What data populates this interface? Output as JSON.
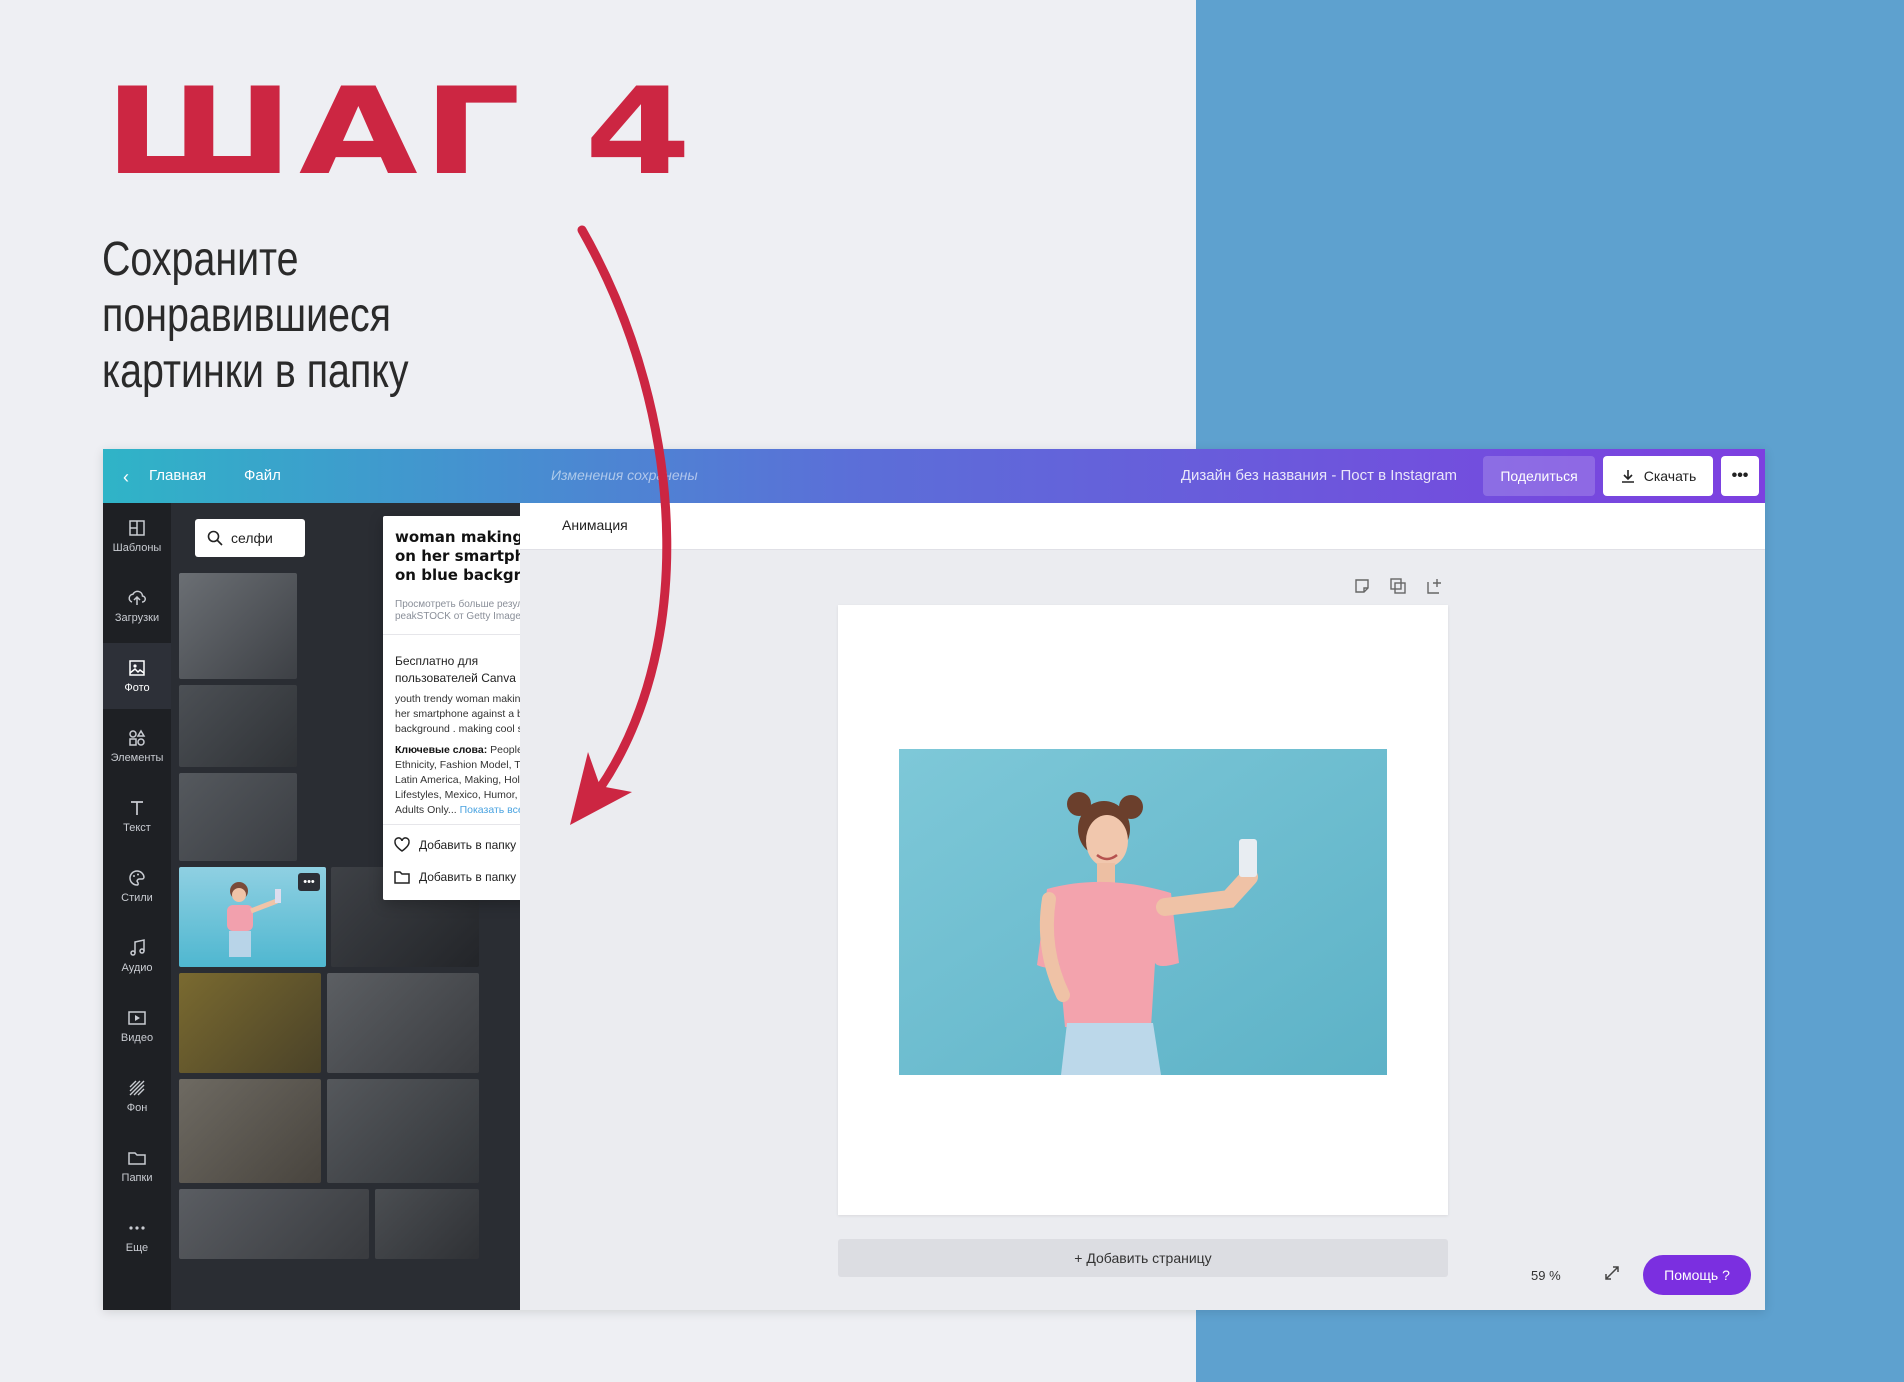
{
  "step": {
    "title": "ШАГ 4",
    "description_lines": [
      "Сохраните",
      "понравившиеся",
      "картинки в папку"
    ]
  },
  "colors": {
    "accent_red": "#cc2642",
    "right_panel_blue": "#5ea1cf",
    "canva_purple": "#7b2fe0"
  },
  "app": {
    "topbar": {
      "back_icon": "chevron-left-icon",
      "home": "Главная",
      "file": "Файл",
      "saving": "Изменения сохранены",
      "doc_name": "Дизайн без названия - Пост в Instagram",
      "share": "Поделиться",
      "download": "Скачать",
      "more": "•••"
    },
    "sidebar": {
      "items": [
        {
          "label": "Шаблоны",
          "icon": "templates-icon"
        },
        {
          "label": "Загрузки",
          "icon": "upload-cloud-icon"
        },
        {
          "label": "Фото",
          "icon": "photo-icon"
        },
        {
          "label": "Элементы",
          "icon": "elements-icon"
        },
        {
          "label": "Текст",
          "icon": "text-icon"
        },
        {
          "label": "Стили",
          "icon": "palette-icon"
        },
        {
          "label": "Аудио",
          "icon": "music-note-icon"
        },
        {
          "label": "Видео",
          "icon": "video-icon"
        },
        {
          "label": "Фон",
          "icon": "background-icon"
        },
        {
          "label": "Папки",
          "icon": "folder-icon"
        },
        {
          "label": "Еще",
          "icon": "more-dots-icon"
        }
      ]
    },
    "search": {
      "value": "селфи"
    },
    "toolbar": {
      "animation": "Анимация"
    },
    "popup": {
      "title": "woman making photo on her smartphone on blue background",
      "more_results": "Просмотреть больше результатов для peakSTOCK от Getty Images Pro",
      "free_for": "Бесплатно для пользователей Canva Pro",
      "info_icon": "info-icon",
      "description": "youth trendy woman making photo on her smartphone against a blue pastel background . making cool selfie",
      "keywords_label": "Ключевые слова:",
      "keywords": " People, Caucasian Ethnicity, Fashion Model, Telephone, Latin America, Making, Holding, Lifestyles, Mexico, Humor, Young Adult, Adults Only...",
      "show_all": " Показать все",
      "add_to_favorites": "Добавить в папку «Понрав...",
      "add_to_folder": "Добавить в папку"
    },
    "canvas": {
      "add_page": "+ Добавить страницу",
      "zoom": "59 %",
      "help": "Помощь  ?"
    }
  }
}
